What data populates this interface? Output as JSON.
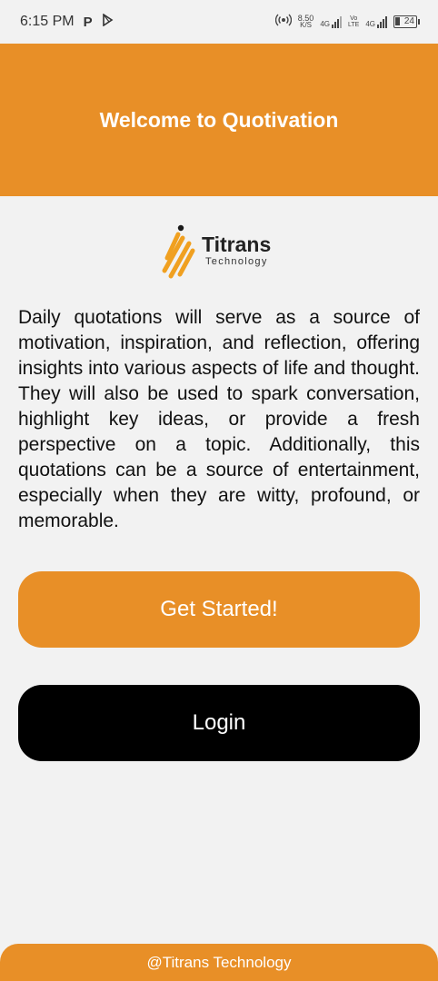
{
  "status_bar": {
    "time": "6:15 PM",
    "left_icons": [
      "parking-icon",
      "play-store-icon"
    ],
    "net_speed_value": "8.50",
    "net_speed_unit": "K/S",
    "sim1_label": "4G",
    "volte_top": "Vo",
    "volte_bottom": "LTE",
    "sim2_label": "4G",
    "battery_level": "24"
  },
  "header": {
    "title": "Welcome to Quotivation",
    "background_color": "#e88f27"
  },
  "logo": {
    "name": "Titrans",
    "subtitle": "Technology",
    "accent_color": "#f0a020"
  },
  "description": "Daily quotations will serve as a source of motivation, inspiration, and reflection, offering insights into various aspects of life and thought. They will also be used to spark conversation, highlight key ideas, or provide a fresh perspective on a topic. Additionally, this quotations can be a source of entertainment, especially when they are witty, profound, or memorable.",
  "buttons": {
    "get_started": "Get Started!",
    "login": "Login",
    "get_started_color": "#e88f27",
    "login_color": "#000000"
  },
  "footer": {
    "text": "@Titrans Technology"
  }
}
